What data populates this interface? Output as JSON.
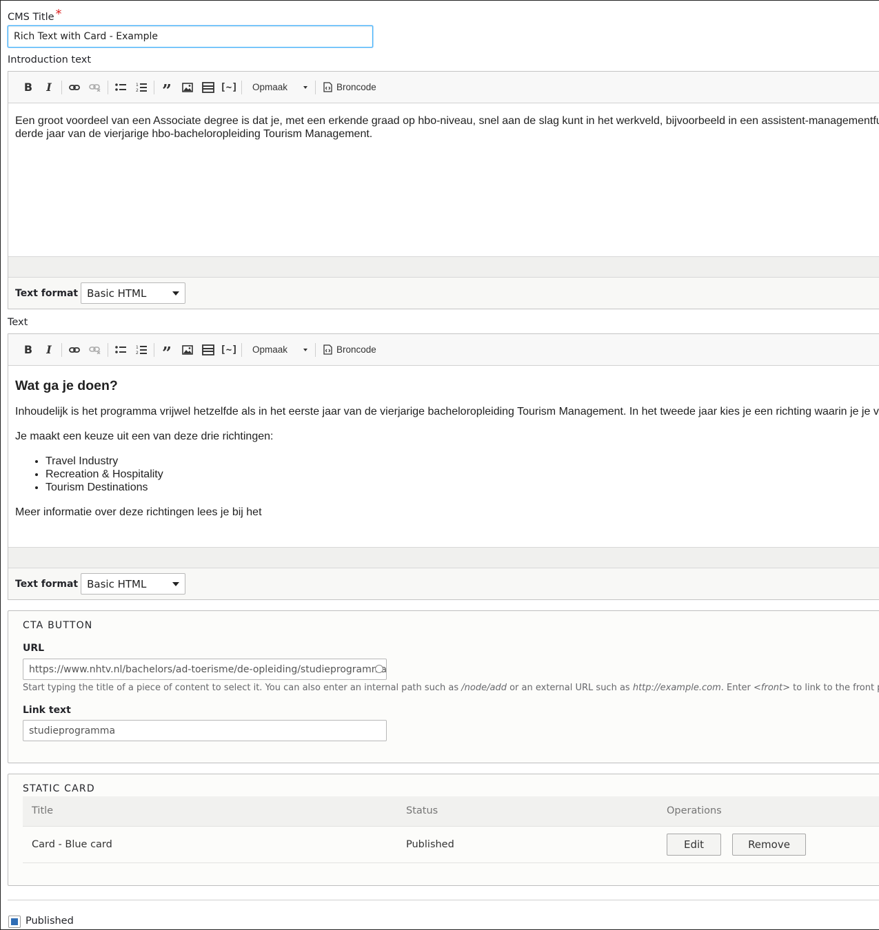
{
  "cms_title": {
    "label": "CMS Title",
    "required_mark": "*",
    "value": "Rich Text with Card - Example"
  },
  "introduction": {
    "label": "Introduction text",
    "toolbar": {
      "format_combo": "Opmaak",
      "source_label": "Broncode"
    },
    "paragraphs": [
      "Een groot voordeel van een Associate degree is dat je, met een erkende graad op hbo-niveau, snel aan de slag kunt in het werkveld, bijvoorbeeld in een assistent-managementfunctie. Je kunt ook doorstromen naar het",
      "derde jaar van de vierjarige hbo-bacheloropleiding Tourism Management."
    ],
    "text_format_label": "Text format",
    "text_format_value": "Basic HTML"
  },
  "text": {
    "label": "Text",
    "toolbar": {
      "format_combo": "Opmaak",
      "source_label": "Broncode"
    },
    "heading": "Wat ga je doen?",
    "paragraph1": "Inhoudelijk is het programma vrijwel hetzelfde als in het eerste jaar van de vierjarige bacheloropleiding Tourism Management. In het tweede jaar kies je een richting waarin je je verder specialiseert.",
    "paragraph2": "Je maakt een keuze uit een van deze drie richtingen:",
    "list": [
      "Travel Industry",
      "Recreation & Hospitality",
      "Tourism Destinations"
    ],
    "paragraph3": "Meer informatie over deze richtingen lees je bij het",
    "text_format_label": "Text format",
    "text_format_value": "Basic HTML"
  },
  "cta_button": {
    "legend": "CTA BUTTON",
    "url_label": "URL",
    "url_value": "https://www.nhtv.nl/bachelors/ad-toerisme/de-opleiding/studieprogramma.html",
    "url_description_parts": {
      "a": "Start typing the title of a piece of content to select it. You can also enter an internal path such as ",
      "b": "/node/add",
      "c": " or an external URL such as ",
      "d": "http://example.com",
      "e": ". Enter ",
      "f": "<front>",
      "g": " to link to the front page."
    },
    "link_text_label": "Link text",
    "link_text_value": "studieprogramma"
  },
  "static_card": {
    "legend": "STATIC CARD",
    "columns": [
      "Title",
      "Status",
      "Operations"
    ],
    "rows": [
      {
        "title": "Card - Blue card",
        "status": "Published",
        "edit": "Edit",
        "remove": "Remove"
      }
    ]
  },
  "published": {
    "label": "Published",
    "checked": true
  },
  "colors": {
    "focus_border": "#40b6ff",
    "required": "#dc2323",
    "checkbox_fill": "#2f6db5"
  }
}
